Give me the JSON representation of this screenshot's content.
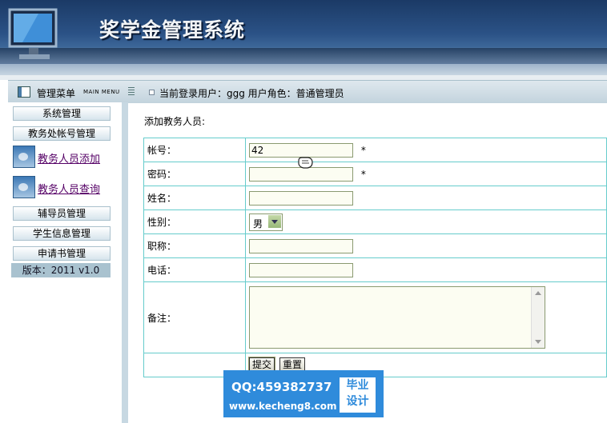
{
  "header": {
    "title": "奖学金管理系统",
    "logo_icon": "monitor-icon"
  },
  "topbar": {
    "menu_label": "管理菜单",
    "menu_sub": "MAIN MENU",
    "user_info": "当前登录用户：ggg   用户角色：普通管理员"
  },
  "sidebar": {
    "items": [
      {
        "label": "系统管理"
      },
      {
        "label": "教务处帐号管理"
      },
      {
        "label": "教务人员添加",
        "icon": "add-user-icon"
      },
      {
        "label": "教务人员查询",
        "icon": "search-user-icon"
      },
      {
        "label": "辅导员管理"
      },
      {
        "label": "学生信息管理"
      },
      {
        "label": "申请书管理"
      }
    ],
    "version": "版本：2011 v1.0"
  },
  "main": {
    "title": "添加教务人员:",
    "fields": {
      "account": {
        "label": "帐号：",
        "value": "42",
        "required": "*"
      },
      "password": {
        "label": "密码：",
        "value": "",
        "required": "*"
      },
      "name": {
        "label": "姓名：",
        "value": ""
      },
      "gender": {
        "label": "性别：",
        "value": "男"
      },
      "title": {
        "label": "职称：",
        "value": ""
      },
      "phone": {
        "label": "电话：",
        "value": ""
      },
      "remark": {
        "label": "备注：",
        "value": ""
      }
    },
    "submit_label": "提交",
    "reset_label": "重置"
  },
  "watermark": {
    "qq": "QQ:459382737",
    "url": "www.kecheng8.com",
    "box_line1": "毕业",
    "box_line2": "设计"
  },
  "colors": {
    "header_dark": "#1b3a66",
    "table_border": "#66cccc",
    "link": "#550066",
    "watermark": "#2f8bdb"
  }
}
